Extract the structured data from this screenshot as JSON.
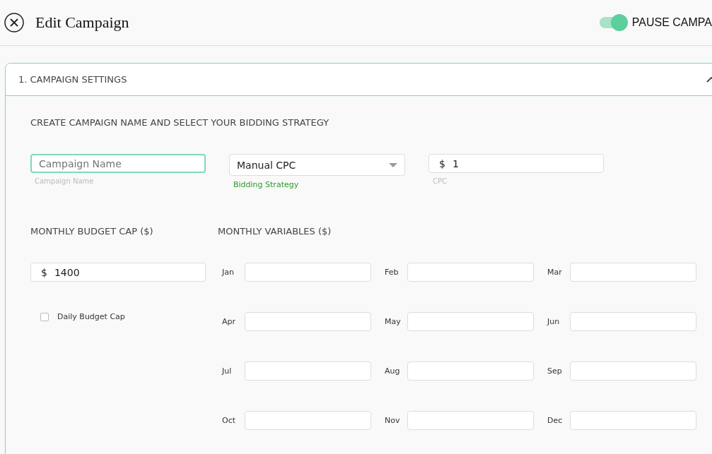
{
  "header": {
    "title": "Edit Campaign",
    "toggle": {
      "label": "PAUSE CAMPA",
      "on": true
    }
  },
  "section": {
    "title": "1. CAMPAIGN SETTINGS",
    "expanded": true,
    "heading": "CREATE CAMPAIGN NAME AND SELECT YOUR BIDDING STRATEGY",
    "campaign_name": {
      "placeholder": "Campaign Name",
      "caption": "Campaign Name"
    },
    "bidding_strategy": {
      "value": "Manual CPC",
      "caption": "Bidding Strategy"
    },
    "cpc": {
      "prefix": "$",
      "value": "1",
      "caption": "CPC"
    },
    "budget_heading": "MONTHLY BUDGET CAP ($)",
    "budget": {
      "prefix": "$",
      "value": "1400"
    },
    "daily_cap": {
      "label": "Daily Budget Cap",
      "checked": false
    },
    "variables_heading": "MONTHLY VARIABLES ($)",
    "months": [
      {
        "label": "Jan"
      },
      {
        "label": "Feb"
      },
      {
        "label": "Mar"
      },
      {
        "label": "Apr"
      },
      {
        "label": "May"
      },
      {
        "label": "Jun"
      },
      {
        "label": "Jul"
      },
      {
        "label": "Aug"
      },
      {
        "label": "Sep"
      },
      {
        "label": "Oct"
      },
      {
        "label": "Nov"
      },
      {
        "label": "Dec"
      }
    ]
  }
}
